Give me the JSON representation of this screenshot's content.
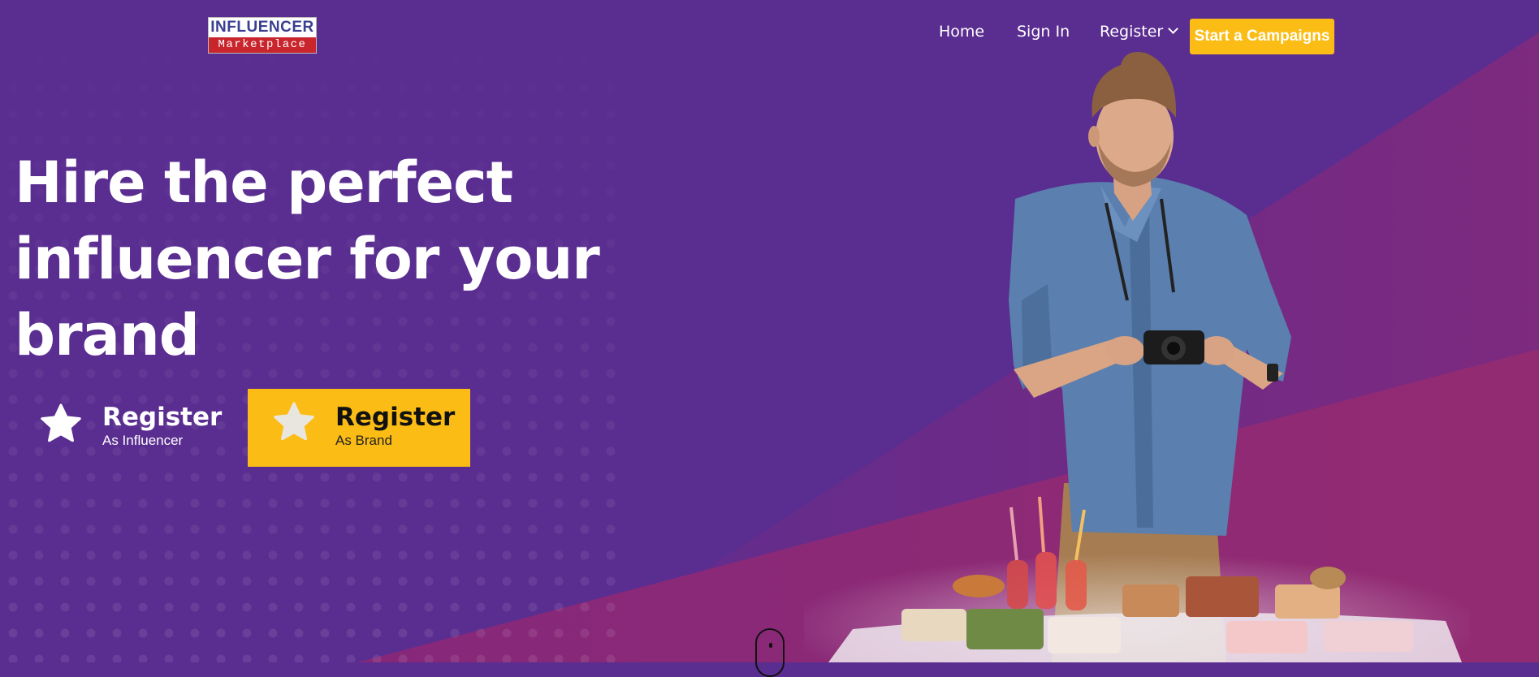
{
  "header": {
    "logo": {
      "top_text": "INFLUENCER",
      "bottom_text": "Marketplace"
    },
    "nav": {
      "home": "Home",
      "sign_in": "Sign In",
      "register": "Register"
    },
    "cta_label": "Start a Campaigns"
  },
  "hero": {
    "headline": "Hire the perfect influencer for your brand",
    "register_influencer": {
      "title": "Register",
      "subtitle": "As Influencer"
    },
    "register_brand": {
      "title": "Register",
      "subtitle": "As Brand"
    }
  },
  "colors": {
    "background": "#5a2d90",
    "accent_band": "#7a2a80",
    "accent_band_light": "#93306f",
    "button_yellow": "#fbbd15",
    "text_white": "#ffffff"
  },
  "icons": [
    "star-icon",
    "chevron-down-icon",
    "scroll-mouse-icon"
  ]
}
